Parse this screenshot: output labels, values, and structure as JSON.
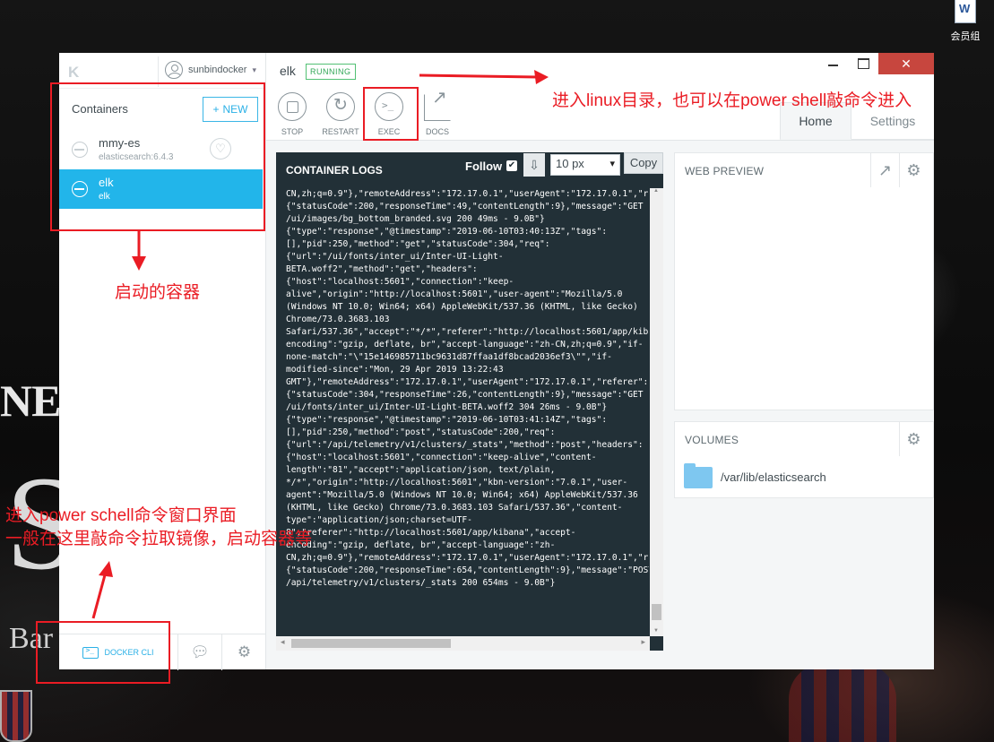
{
  "desktop": {
    "icon_label": "会员组",
    "background_words": {
      "top": "NEU",
      "big": "S",
      "bottom": "Bar"
    }
  },
  "app": {
    "logo": "K",
    "username": "sunbindocker",
    "sidebar": {
      "title": "Containers",
      "new_button": "NEW",
      "containers": [
        {
          "name": "mmy-es",
          "image": "elasticsearch:6.4.3",
          "selected": false
        },
        {
          "name": "elk",
          "image": "elk",
          "selected": true
        }
      ],
      "docker_cli_label": "DOCKER CLI"
    },
    "header": {
      "container_name": "elk",
      "status": "RUNNING",
      "status_color": "#52c174",
      "tools": [
        {
          "icon": "stop-icon",
          "label": "STOP"
        },
        {
          "icon": "restart-icon",
          "label": "RESTART"
        },
        {
          "icon": "exec-icon",
          "label": "EXEC"
        },
        {
          "icon": "docs-icon",
          "label": "DOCS"
        }
      ],
      "tabs": [
        {
          "label": "Home",
          "active": true
        },
        {
          "label": "Settings",
          "active": false
        }
      ],
      "close_glyph": "✕"
    },
    "logs": {
      "title": "CONTAINER LOGS",
      "follow_label": "Follow",
      "follow_checked": true,
      "font_size": "10 px",
      "copy_label": "Copy",
      "text": "CN,zh;q=0.9\"},\"remoteAddress\":\"172.17.0.1\",\"userAgent\":\"172.17.0.1\",\"referer\n{\"statusCode\":200,\"responseTime\":49,\"contentLength\":9},\"message\":\"GET\n/ui/images/bg_bottom_branded.svg 200 49ms - 9.0B\"}\n{\"type\":\"response\",\"@timestamp\":\"2019-06-10T03:40:13Z\",\"tags\":\n[],\"pid\":250,\"method\":\"get\",\"statusCode\":304,\"req\":\n{\"url\":\"/ui/fonts/inter_ui/Inter-UI-Light-\nBETA.woff2\",\"method\":\"get\",\"headers\":\n{\"host\":\"localhost:5601\",\"connection\":\"keep-\nalive\",\"origin\":\"http://localhost:5601\",\"user-agent\":\"Mozilla/5.0\n(Windows NT 10.0; Win64; x64) AppleWebKit/537.36 (KHTML, like Gecko)\nChrome/73.0.3683.103\nSafari/537.36\",\"accept\":\"*/*\",\"referer\":\"http://localhost:5601/app/kibana\"\nencoding\":\"gzip, deflate, br\",\"accept-language\":\"zh-CN,zh;q=0.9\",\"if-\nnone-match\":\"\\\"15e146985711bc9631d87ffaa1df8bcad2036ef3\\\"\",\"if-\nmodified-since\":\"Mon, 29 Apr 2019 13:22:43\nGMT\"},\"remoteAddress\":\"172.17.0.1\",\"userAgent\":\"172.17.0.1\",\"referer\":\"htt\n{\"statusCode\":304,\"responseTime\":26,\"contentLength\":9},\"message\":\"GET\n/ui/fonts/inter_ui/Inter-UI-Light-BETA.woff2 304 26ms - 9.0B\"}\n{\"type\":\"response\",\"@timestamp\":\"2019-06-10T03:41:14Z\",\"tags\":\n[],\"pid\":250,\"method\":\"post\",\"statusCode\":200,\"req\":\n{\"url\":\"/api/telemetry/v1/clusters/_stats\",\"method\":\"post\",\"headers\":\n{\"host\":\"localhost:5601\",\"connection\":\"keep-alive\",\"content-\nlength\":\"81\",\"accept\":\"application/json, text/plain,\n*/*\",\"origin\":\"http://localhost:5601\",\"kbn-version\":\"7.0.1\",\"user-\nagent\":\"Mozilla/5.0 (Windows NT 10.0; Win64; x64) AppleWebKit/537.36\n(KHTML, like Gecko) Chrome/73.0.3683.103 Safari/537.36\",\"content-\ntype\":\"application/json;charset=UTF-\n8\",\"referer\":\"http://localhost:5601/app/kibana\",\"accept-\nencoding\":\"gzip, deflate, br\",\"accept-language\":\"zh-\nCN,zh;q=0.9\"},\"remoteAddress\":\"172.17.0.1\",\"userAgent\":\"172.17.0.1\",\"refer\n{\"statusCode\":200,\"responseTime\":654,\"contentLength\":9},\"message\":\"POST\n/api/telemetry/v1/clusters/_stats 200 654ms - 9.0B\"}"
    },
    "web_preview": {
      "title": "WEB PREVIEW"
    },
    "volumes": {
      "title": "VOLUMES",
      "path": "/var/lib/elasticsearch"
    }
  },
  "annotations": {
    "linux": "进入linux目录，也可以在power shell敲命令进入",
    "started": "启动的容器",
    "powershell_line1": "进入power schell命令窗口界面",
    "powershell_line2": "一般在这里敲命令拉取镜像，启动容器等",
    "color": "#ea1c24"
  }
}
